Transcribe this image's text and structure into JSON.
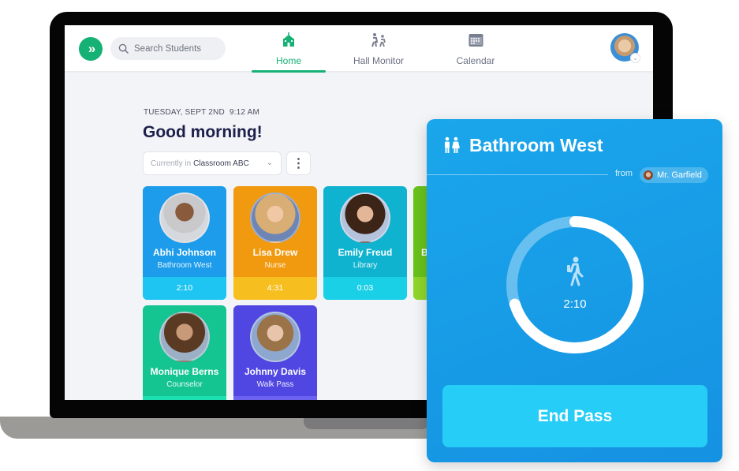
{
  "app": {
    "logo_icon": "double-chevron-right-icon",
    "search": {
      "placeholder": "Search Students",
      "icon": "search-icon"
    },
    "nav": [
      {
        "label": "Home",
        "icon": "school-icon",
        "active": true
      },
      {
        "label": "Hall Monitor",
        "icon": "walking-people-icon",
        "active": false
      },
      {
        "label": "Calendar",
        "icon": "calendar-icon",
        "active": false
      }
    ],
    "user_avatar_icon": "chevron-down-icon"
  },
  "home": {
    "date": "TUESDAY, SEPT 2ND",
    "time": "9:12 AM",
    "greeting": "Good morning!",
    "location": {
      "prefix": "Currently in",
      "value": "Classroom ABC"
    },
    "more_label": "⋮"
  },
  "students": [
    {
      "name": "Abhi Johnson",
      "destination": "Bathroom West",
      "elapsed": "2:10"
    },
    {
      "name": "Lisa Drew",
      "destination": "Nurse",
      "elapsed": "4:31"
    },
    {
      "name": "Emily Freud",
      "destination": "Library",
      "elapsed": "0:03"
    },
    {
      "name": "B",
      "destination": "",
      "elapsed": ""
    },
    {
      "name": "Monique Berns",
      "destination": "Counselor",
      "elapsed": ""
    },
    {
      "name": "Johnny Davis",
      "destination": "Walk Pass",
      "elapsed": ""
    }
  ],
  "pass": {
    "title": "Bathroom West",
    "title_icon": "restroom-icon",
    "from_label": "from",
    "teacher": "Mr. Garfield",
    "timer": "2:10",
    "timer_icon": "walking-person-icon",
    "progress": 0.7,
    "end_label": "End Pass"
  },
  "colors": {
    "brand_green": "#16b174",
    "pass_blue": "#1aa6eb",
    "end_button": "#26cdf6"
  }
}
